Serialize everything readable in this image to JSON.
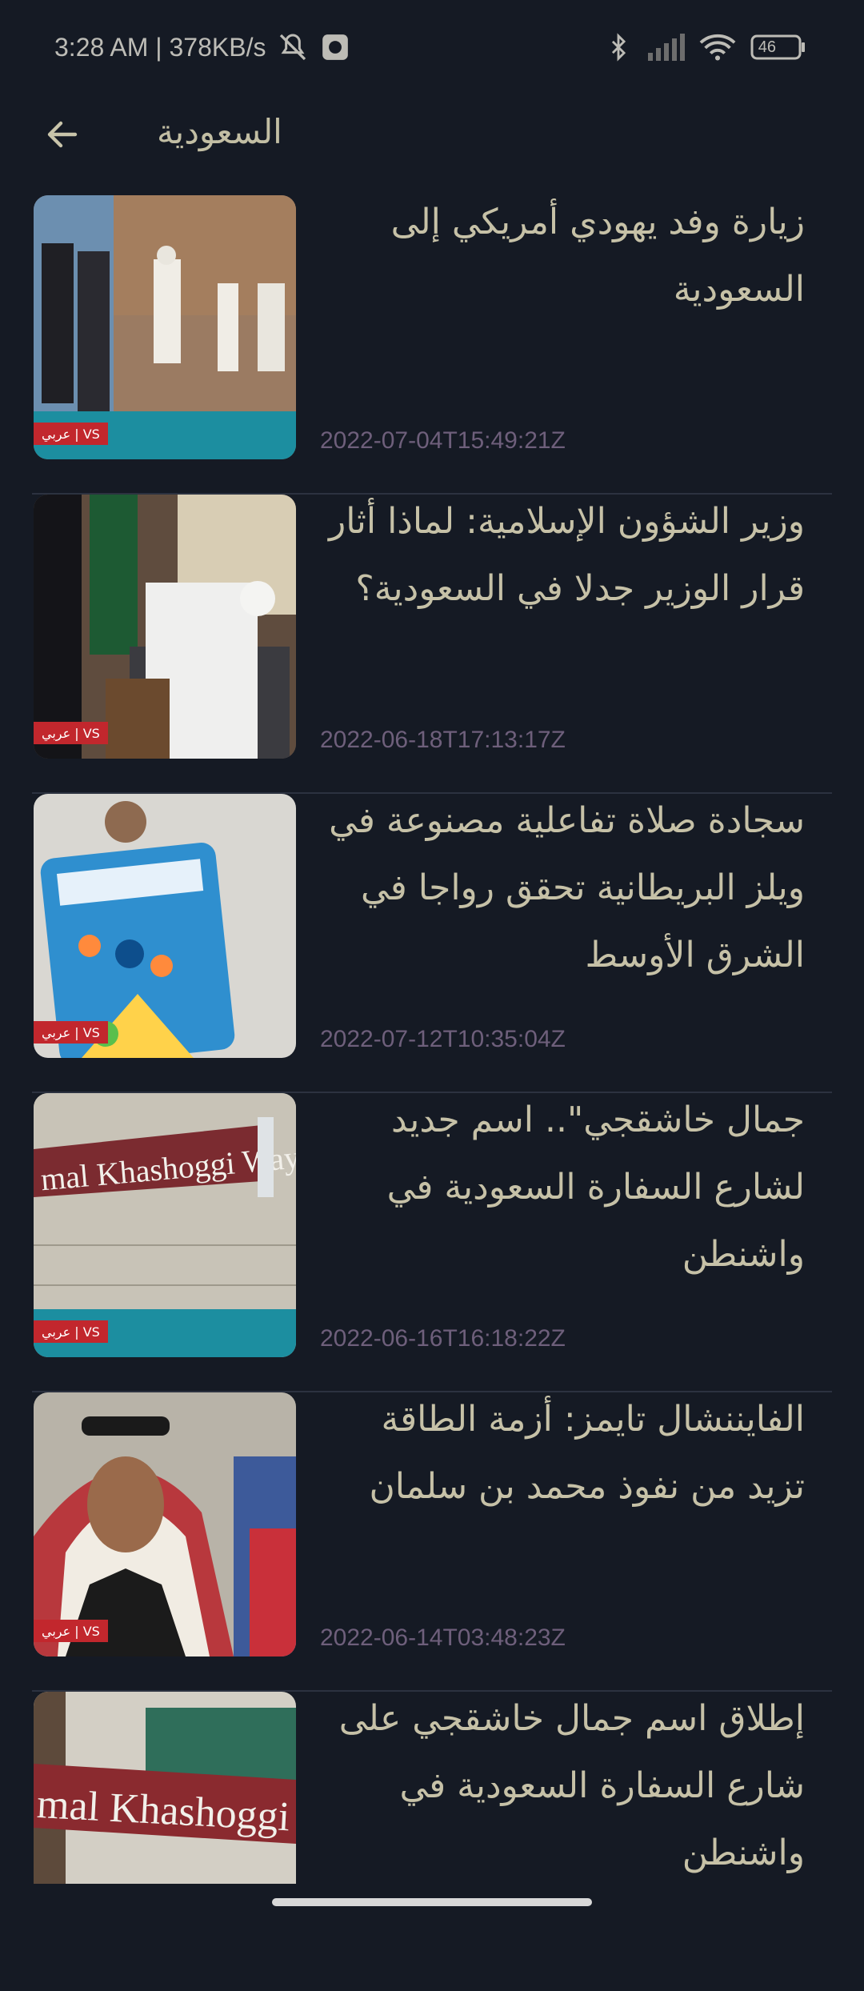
{
  "status_bar": {
    "time_speed": "3:28 AM | 378KB/s",
    "battery": "46"
  },
  "app_bar": {
    "title": "السعودية"
  },
  "articles": [
    {
      "title": "زيارة وفد يهودي أمريكي إلى السعودية",
      "date": "2022-07-04T15:49:21Z",
      "badge": "عربي | VS"
    },
    {
      "title": "وزير الشؤون الإسلامية: لماذا أثار قرار الوزير جدلا في السعودية؟",
      "date": "2022-06-18T17:13:17Z",
      "badge": "عربي | VS"
    },
    {
      "title": "سجادة صلاة تفاعلية مصنوعة في ويلز البريطانية تحقق رواجا في الشرق الأوسط",
      "date": "2022-07-12T10:35:04Z",
      "badge": "عربي | VS"
    },
    {
      "title": "جمال خاشقجي\".. اسم جديد لشارع السفارة السعودية في واشنطن",
      "date": "2022-06-16T16:18:22Z",
      "badge": "عربي | VS",
      "sign_text": "mal Khashoggi Way"
    },
    {
      "title": "الفايننشال تايمز: أزمة الطاقة تزيد من نفوذ محمد بن سلمان",
      "date": "2022-06-14T03:48:23Z",
      "badge": "عربي | VS"
    },
    {
      "title": "إطلاق اسم جمال خاشقجي على شارع السفارة السعودية في واشنطن",
      "date": "",
      "sign_text": "mal Khashoggi Wa"
    }
  ],
  "icons": [
    "back-arrow-icon",
    "bluetooth-icon",
    "signal-icon",
    "wifi-icon",
    "battery-icon",
    "mute-icon",
    "camera-icon"
  ]
}
